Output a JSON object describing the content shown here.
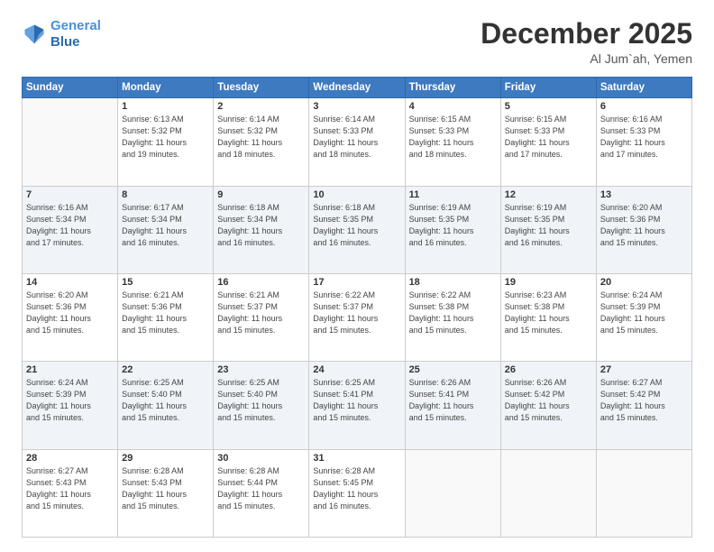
{
  "logo": {
    "line1": "General",
    "line2": "Blue"
  },
  "header": {
    "title": "December 2025",
    "subtitle": "Al Jum`ah, Yemen"
  },
  "weekdays": [
    "Sunday",
    "Monday",
    "Tuesday",
    "Wednesday",
    "Thursday",
    "Friday",
    "Saturday"
  ],
  "rows": [
    [
      {
        "day": "",
        "sunrise": "",
        "sunset": "",
        "daylight": ""
      },
      {
        "day": "1",
        "sunrise": "Sunrise: 6:13 AM",
        "sunset": "Sunset: 5:32 PM",
        "daylight": "Daylight: 11 hours and 19 minutes."
      },
      {
        "day": "2",
        "sunrise": "Sunrise: 6:14 AM",
        "sunset": "Sunset: 5:32 PM",
        "daylight": "Daylight: 11 hours and 18 minutes."
      },
      {
        "day": "3",
        "sunrise": "Sunrise: 6:14 AM",
        "sunset": "Sunset: 5:33 PM",
        "daylight": "Daylight: 11 hours and 18 minutes."
      },
      {
        "day": "4",
        "sunrise": "Sunrise: 6:15 AM",
        "sunset": "Sunset: 5:33 PM",
        "daylight": "Daylight: 11 hours and 18 minutes."
      },
      {
        "day": "5",
        "sunrise": "Sunrise: 6:15 AM",
        "sunset": "Sunset: 5:33 PM",
        "daylight": "Daylight: 11 hours and 17 minutes."
      },
      {
        "day": "6",
        "sunrise": "Sunrise: 6:16 AM",
        "sunset": "Sunset: 5:33 PM",
        "daylight": "Daylight: 11 hours and 17 minutes."
      }
    ],
    [
      {
        "day": "7",
        "sunrise": "Sunrise: 6:16 AM",
        "sunset": "Sunset: 5:34 PM",
        "daylight": "Daylight: 11 hours and 17 minutes."
      },
      {
        "day": "8",
        "sunrise": "Sunrise: 6:17 AM",
        "sunset": "Sunset: 5:34 PM",
        "daylight": "Daylight: 11 hours and 16 minutes."
      },
      {
        "day": "9",
        "sunrise": "Sunrise: 6:18 AM",
        "sunset": "Sunset: 5:34 PM",
        "daylight": "Daylight: 11 hours and 16 minutes."
      },
      {
        "day": "10",
        "sunrise": "Sunrise: 6:18 AM",
        "sunset": "Sunset: 5:35 PM",
        "daylight": "Daylight: 11 hours and 16 minutes."
      },
      {
        "day": "11",
        "sunrise": "Sunrise: 6:19 AM",
        "sunset": "Sunset: 5:35 PM",
        "daylight": "Daylight: 11 hours and 16 minutes."
      },
      {
        "day": "12",
        "sunrise": "Sunrise: 6:19 AM",
        "sunset": "Sunset: 5:35 PM",
        "daylight": "Daylight: 11 hours and 16 minutes."
      },
      {
        "day": "13",
        "sunrise": "Sunrise: 6:20 AM",
        "sunset": "Sunset: 5:36 PM",
        "daylight": "Daylight: 11 hours and 15 minutes."
      }
    ],
    [
      {
        "day": "14",
        "sunrise": "Sunrise: 6:20 AM",
        "sunset": "Sunset: 5:36 PM",
        "daylight": "Daylight: 11 hours and 15 minutes."
      },
      {
        "day": "15",
        "sunrise": "Sunrise: 6:21 AM",
        "sunset": "Sunset: 5:36 PM",
        "daylight": "Daylight: 11 hours and 15 minutes."
      },
      {
        "day": "16",
        "sunrise": "Sunrise: 6:21 AM",
        "sunset": "Sunset: 5:37 PM",
        "daylight": "Daylight: 11 hours and 15 minutes."
      },
      {
        "day": "17",
        "sunrise": "Sunrise: 6:22 AM",
        "sunset": "Sunset: 5:37 PM",
        "daylight": "Daylight: 11 hours and 15 minutes."
      },
      {
        "day": "18",
        "sunrise": "Sunrise: 6:22 AM",
        "sunset": "Sunset: 5:38 PM",
        "daylight": "Daylight: 11 hours and 15 minutes."
      },
      {
        "day": "19",
        "sunrise": "Sunrise: 6:23 AM",
        "sunset": "Sunset: 5:38 PM",
        "daylight": "Daylight: 11 hours and 15 minutes."
      },
      {
        "day": "20",
        "sunrise": "Sunrise: 6:24 AM",
        "sunset": "Sunset: 5:39 PM",
        "daylight": "Daylight: 11 hours and 15 minutes."
      }
    ],
    [
      {
        "day": "21",
        "sunrise": "Sunrise: 6:24 AM",
        "sunset": "Sunset: 5:39 PM",
        "daylight": "Daylight: 11 hours and 15 minutes."
      },
      {
        "day": "22",
        "sunrise": "Sunrise: 6:25 AM",
        "sunset": "Sunset: 5:40 PM",
        "daylight": "Daylight: 11 hours and 15 minutes."
      },
      {
        "day": "23",
        "sunrise": "Sunrise: 6:25 AM",
        "sunset": "Sunset: 5:40 PM",
        "daylight": "Daylight: 11 hours and 15 minutes."
      },
      {
        "day": "24",
        "sunrise": "Sunrise: 6:25 AM",
        "sunset": "Sunset: 5:41 PM",
        "daylight": "Daylight: 11 hours and 15 minutes."
      },
      {
        "day": "25",
        "sunrise": "Sunrise: 6:26 AM",
        "sunset": "Sunset: 5:41 PM",
        "daylight": "Daylight: 11 hours and 15 minutes."
      },
      {
        "day": "26",
        "sunrise": "Sunrise: 6:26 AM",
        "sunset": "Sunset: 5:42 PM",
        "daylight": "Daylight: 11 hours and 15 minutes."
      },
      {
        "day": "27",
        "sunrise": "Sunrise: 6:27 AM",
        "sunset": "Sunset: 5:42 PM",
        "daylight": "Daylight: 11 hours and 15 minutes."
      }
    ],
    [
      {
        "day": "28",
        "sunrise": "Sunrise: 6:27 AM",
        "sunset": "Sunset: 5:43 PM",
        "daylight": "Daylight: 11 hours and 15 minutes."
      },
      {
        "day": "29",
        "sunrise": "Sunrise: 6:28 AM",
        "sunset": "Sunset: 5:43 PM",
        "daylight": "Daylight: 11 hours and 15 minutes."
      },
      {
        "day": "30",
        "sunrise": "Sunrise: 6:28 AM",
        "sunset": "Sunset: 5:44 PM",
        "daylight": "Daylight: 11 hours and 15 minutes."
      },
      {
        "day": "31",
        "sunrise": "Sunrise: 6:28 AM",
        "sunset": "Sunset: 5:45 PM",
        "daylight": "Daylight: 11 hours and 16 minutes."
      },
      {
        "day": "",
        "sunrise": "",
        "sunset": "",
        "daylight": ""
      },
      {
        "day": "",
        "sunrise": "",
        "sunset": "",
        "daylight": ""
      },
      {
        "day": "",
        "sunrise": "",
        "sunset": "",
        "daylight": ""
      }
    ]
  ]
}
